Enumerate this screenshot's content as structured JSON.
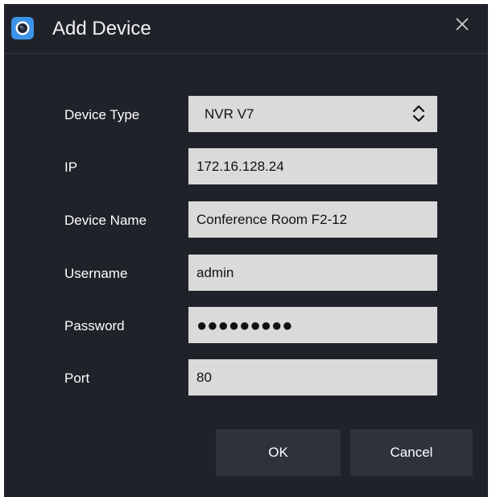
{
  "dialog": {
    "title": "Add Device",
    "icon": "camera-lens-icon",
    "close_icon": "close-icon"
  },
  "form": {
    "device_type": {
      "label": "Device Type",
      "value": "NVR V7"
    },
    "ip": {
      "label": "IP",
      "value": "172.16.128.24"
    },
    "device_name": {
      "label": "Device Name",
      "value": "Conference Room F2-12"
    },
    "username": {
      "label": "Username",
      "value": "admin"
    },
    "password": {
      "label": "Password",
      "value": "●●●●●●●●●"
    },
    "port": {
      "label": "Port",
      "value": "80"
    }
  },
  "buttons": {
    "ok": "OK",
    "cancel": "Cancel"
  },
  "colors": {
    "background": "#1f2229",
    "field": "#dadada",
    "button": "#2e323d",
    "accent": "#3d93e6"
  }
}
